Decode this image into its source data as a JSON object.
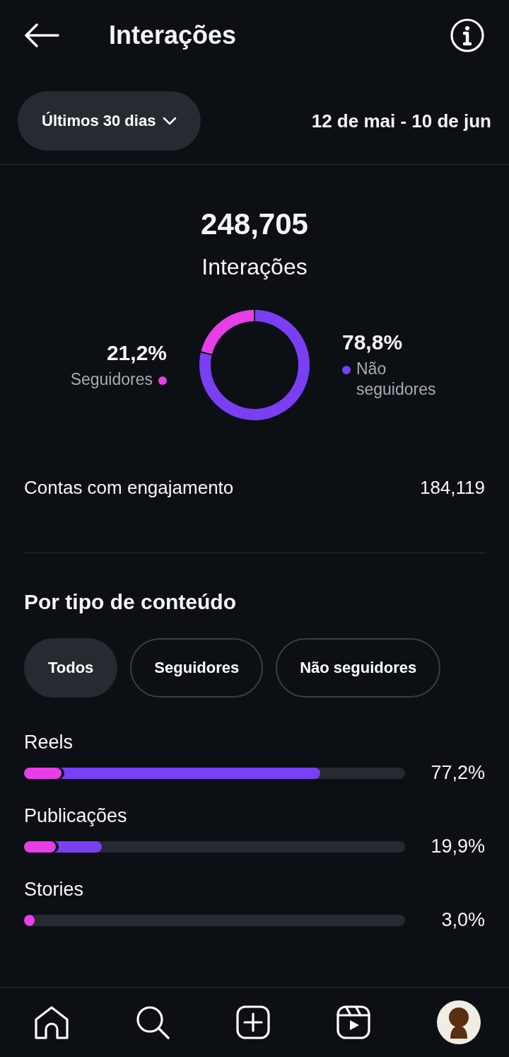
{
  "header": {
    "title": "Interações"
  },
  "filter": {
    "period": "Últimos 30 dias",
    "date_range": "12 de mai - 10 de jun"
  },
  "summary": {
    "total": "248,705",
    "breakdown": [
      {
        "percent": "21,2%",
        "color": "#e83ee8"
      },
      {
        "percent": "78,8%",
        "color": "#7a3ff2"
      }
    ],
    "chart_data": {
      "type": "donut",
      "categories": [
        "Seguidores",
        "Não seguidores"
      ],
      "series": [
        {
          "name": "Interações",
          "values": [
            21.2,
            78.8
          ]
        }
      ]
    }
  },
  "engaged": {
    "label": "Contas com engajamento",
    "value": "184,119"
  },
  "content_type": {
    "title": "Por tipo de conteúdo",
    "chips": [
      {
        "label": "Todos",
        "selected": true
      },
      {
        "label": "Seguidores",
        "selected": false
      },
      {
        "label": "Não seguidores",
        "selected": false
      }
    ],
    "rows": [
      {
        "label": "Reels",
        "percent": "77,2%",
        "segments": [
          {
            "level": 0.098,
            "color": "#e83ee8"
          },
          {
            "level": 0.777,
            "color": "#7a3ff2"
          }
        ]
      },
      {
        "label": "Publicações",
        "percent": "19,9%",
        "segments": [
          {
            "level": 0.083,
            "color": "#e83ee8"
          },
          {
            "level": 0.204,
            "color": "#7a3ff2"
          }
        ]
      },
      {
        "label": "Stories",
        "percent": "3,0%",
        "segments": [
          {
            "level": 0.028,
            "color": "#e83ee8"
          }
        ]
      }
    ]
  },
  "nav": [
    {
      "kind": "home"
    },
    {
      "kind": "search"
    },
    {
      "kind": "create"
    },
    {
      "kind": "reels"
    },
    {
      "kind": "profile"
    }
  ]
}
